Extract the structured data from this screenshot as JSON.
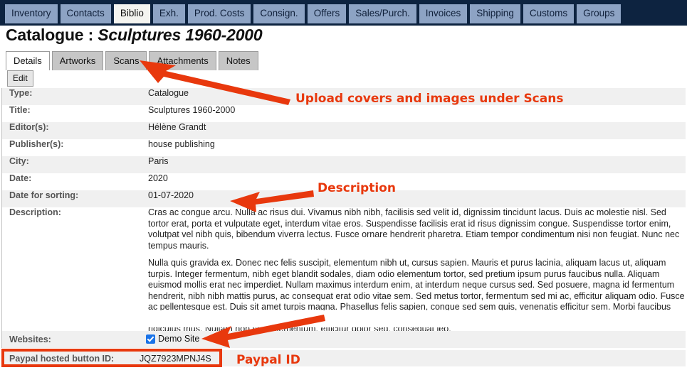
{
  "topnav": {
    "tabs": [
      {
        "label": "Inventory",
        "active": false
      },
      {
        "label": "Contacts",
        "active": false
      },
      {
        "label": "Biblio",
        "active": true
      },
      {
        "label": "Exh.",
        "active": false
      },
      {
        "label": "Prod. Costs",
        "active": false
      },
      {
        "label": "Consign.",
        "active": false
      },
      {
        "label": "Offers",
        "active": false
      },
      {
        "label": "Sales/Purch.",
        "active": false
      },
      {
        "label": "Invoices",
        "active": false
      },
      {
        "label": "Shipping",
        "active": false
      },
      {
        "label": "Customs",
        "active": false
      },
      {
        "label": "Groups",
        "active": false
      }
    ]
  },
  "header": {
    "prefix": "Catalogue : ",
    "record_title": "Sculptures 1960-2000"
  },
  "subtabs": [
    {
      "label": "Details",
      "active": true
    },
    {
      "label": "Artworks",
      "active": false
    },
    {
      "label": "Scans",
      "active": false
    },
    {
      "label": "Attachments",
      "active": false
    },
    {
      "label": "Notes",
      "active": false
    }
  ],
  "toolbar": {
    "edit_label": "Edit"
  },
  "details": {
    "rows": [
      {
        "label": "Type:",
        "value": "Catalogue"
      },
      {
        "label": "Title:",
        "value": "Sculptures 1960-2000"
      },
      {
        "label": "Editor(s):",
        "value": "Hélène Grandt"
      },
      {
        "label": "Publisher(s):",
        "value": "house publishing"
      },
      {
        "label": "City:",
        "value": "Paris"
      },
      {
        "label": "Date:",
        "value": "2020"
      },
      {
        "label": "Date for sorting:",
        "value": "01-07-2020"
      }
    ],
    "description_label": "Description:",
    "description_paragraphs": [
      "Cras ac congue arcu. Nulla ac risus dui. Vivamus nibh nibh, facilisis sed velit id, dignissim tincidunt lacus. Duis ac molestie nisl. Sed tortor erat, porta et vulputate eget, interdum vitae eros. Suspendisse facilisis erat id risus dignissim congue. Suspendisse tortor enim, volutpat vel nibh quis, bibendum viverra lectus. Fusce ornare hendrerit pharetra. Etiam tempor condimentum nisi non feugiat. Nunc nec tempus mauris.",
      "Nulla quis gravida ex. Donec nec felis suscipit, elementum nibh ut, cursus sapien. Mauris et purus lacinia, aliquam lacus ut, aliquam turpis. Integer fermentum, nibh eget blandit sodales, diam odio elementum tortor, sed pretium ipsum purus faucibus nulla. Aliquam euismod mollis erat nec imperdiet. Nullam maximus interdum enim, at interdum neque cursus sed. Sed posuere, magna id fermentum hendrerit, nibh nibh mattis purus, ac consequat erat odio vitae sem. Sed metus tortor, fermentum sed mi ac, efficitur aliquam odio. Fusce ac pellentesque est. Duis sit amet turpis magna. Phasellus felis sapien, congue sed sem quis, venenatis efficitur sem. Morbi faucibus efficitur imperdiet. Nam aliquet sit amet sem eget aliquet. Orci varius natoque penatibus et magnis dis parturient montes, nascetur ridiculus mus. Nullam non sem elementum, efficitur dolor sed, consequat leo."
    ],
    "websites_label": "Websites:",
    "websites_option": "Demo Site",
    "paypal_label": "Paypal hosted button ID:",
    "paypal_value": "JQZ7923MPNJ4S"
  },
  "annotations": [
    {
      "text": "Upload covers and images under Scans"
    },
    {
      "text": "Description"
    },
    {
      "text": "Paypal ID"
    }
  ],
  "colors": {
    "topbar_bg": "#0d2340",
    "nav_tab_bg": "#8da3c4",
    "annotation_red": "#e8380d",
    "checkbox_blue": "#1a73e8",
    "row_alt_bg": "#f0f0f0"
  }
}
